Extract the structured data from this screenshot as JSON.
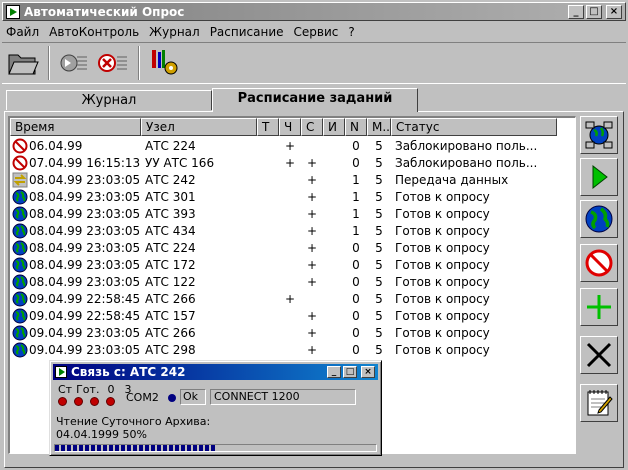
{
  "window": {
    "title": "Автоматический Опрос"
  },
  "menu": [
    "Файл",
    "АвтоКонтроль",
    "Журнал",
    "Расписание",
    "Сервис",
    "?"
  ],
  "toolbar": {
    "buttons": [
      {
        "name": "open-folder-icon"
      },
      {
        "name": "forward-icon"
      },
      {
        "name": "cancel-icon"
      },
      {
        "name": "settings-icon"
      }
    ]
  },
  "tabs": [
    {
      "label": "Журнал",
      "active": false
    },
    {
      "label": "Расписание заданий",
      "active": true
    }
  ],
  "table": {
    "columns": [
      "Время",
      "Узел",
      "Т",
      "Ч",
      "С",
      "И",
      "N",
      "М..",
      "Статус"
    ],
    "rows": [
      {
        "icon": "blocked-icon",
        "time": "06.04.99",
        "node": "АТС 224",
        "t": "",
        "ch": "+",
        "s": "",
        "i": "",
        "n": "0",
        "m": "5",
        "status": "Заблокировано поль..."
      },
      {
        "icon": "blocked-icon",
        "time": "07.04.99 16:15:13",
        "node": "УУ АТС 166",
        "t": "",
        "ch": "+",
        "s": "+",
        "i": "",
        "n": "0",
        "m": "5",
        "status": "Заблокировано поль..."
      },
      {
        "icon": "transfer-icon",
        "time": "08.04.99 23:03:05",
        "node": "АТС 242",
        "t": "",
        "ch": "",
        "s": "+",
        "i": "",
        "n": "1",
        "m": "5",
        "status": "Передача данных"
      },
      {
        "icon": "globe-icon",
        "time": "08.04.99 23:03:05",
        "node": "АТС 301",
        "t": "",
        "ch": "",
        "s": "+",
        "i": "",
        "n": "1",
        "m": "5",
        "status": "Готов к опросу"
      },
      {
        "icon": "globe-icon",
        "time": "08.04.99 23:03:05",
        "node": "АТС 393",
        "t": "",
        "ch": "",
        "s": "+",
        "i": "",
        "n": "1",
        "m": "5",
        "status": "Готов к опросу"
      },
      {
        "icon": "globe-icon",
        "time": "08.04.99 23:03:05",
        "node": "АТС 434",
        "t": "",
        "ch": "",
        "s": "+",
        "i": "",
        "n": "1",
        "m": "5",
        "status": "Готов к опросу"
      },
      {
        "icon": "globe-icon",
        "time": "08.04.99 23:03:05",
        "node": "АТС 224",
        "t": "",
        "ch": "",
        "s": "+",
        "i": "",
        "n": "0",
        "m": "5",
        "status": "Готов к опросу"
      },
      {
        "icon": "globe-icon",
        "time": "08.04.99 23:03:05",
        "node": "АТС 172",
        "t": "",
        "ch": "",
        "s": "+",
        "i": "",
        "n": "0",
        "m": "5",
        "status": "Готов к опросу"
      },
      {
        "icon": "globe-icon",
        "time": "08.04.99 23:03:05",
        "node": "АТС 122",
        "t": "",
        "ch": "",
        "s": "+",
        "i": "",
        "n": "0",
        "m": "5",
        "status": "Готов к опросу"
      },
      {
        "icon": "globe-icon",
        "time": "09.04.99 22:58:45",
        "node": "АТС 266",
        "t": "",
        "ch": "+",
        "s": "",
        "i": "",
        "n": "0",
        "m": "5",
        "status": "Готов к опросу"
      },
      {
        "icon": "globe-icon",
        "time": "09.04.99 22:58:45",
        "node": "АТС 157",
        "t": "",
        "ch": "",
        "s": "+",
        "i": "",
        "n": "0",
        "m": "5",
        "status": "Готов к опросу"
      },
      {
        "icon": "globe-icon",
        "time": "09.04.99 23:03:05",
        "node": "АТС 266",
        "t": "",
        "ch": "",
        "s": "+",
        "i": "",
        "n": "0",
        "m": "5",
        "status": "Готов к опросу"
      },
      {
        "icon": "globe-icon",
        "time": "09.04.99 23:03:05",
        "node": "АТС 298",
        "t": "",
        "ch": "",
        "s": "+",
        "i": "",
        "n": "0",
        "m": "5",
        "status": "Готов к опросу"
      }
    ]
  },
  "side_buttons": [
    {
      "name": "network-nodes-button",
      "icon": "network-icon"
    },
    {
      "name": "run-button",
      "icon": "play-icon"
    },
    {
      "name": "globe-button",
      "icon": "globe-icon"
    },
    {
      "name": "block-button",
      "icon": "no-entry-icon"
    },
    {
      "name": "add-button",
      "icon": "plus-icon"
    },
    {
      "name": "delete-button",
      "icon": "cross-icon"
    },
    {
      "name": "edit-button",
      "icon": "notepad-icon"
    }
  ],
  "connection": {
    "title": "Связь с: АТС 242",
    "led_labels": [
      "Ст",
      "Гот.",
      "0",
      "3"
    ],
    "port": "COM2",
    "status": "Ok",
    "message": "CONNECT 1200",
    "archive_line": "Чтение Суточного Архива:",
    "archive_progress_text": "04.04.1999 50%",
    "progress": 0.5
  },
  "colors": {
    "titlebar_inactive": "#808080",
    "titlebar_active": "#000080",
    "led": "#c00000"
  }
}
